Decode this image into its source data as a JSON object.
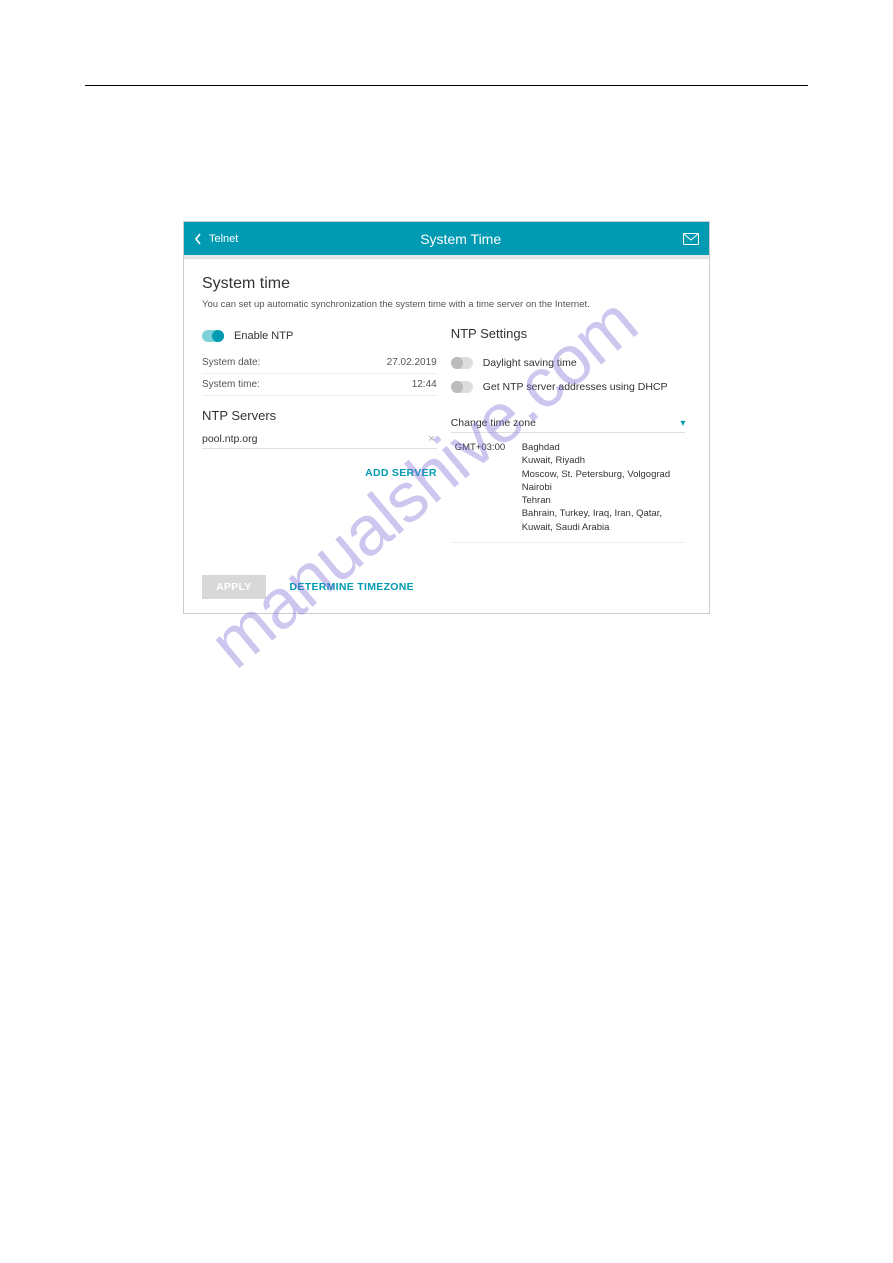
{
  "header": {
    "back_label": "Telnet",
    "title": "System Time"
  },
  "section": {
    "heading": "System time",
    "description": "You can set up automatic synchronization the system time with a time server on the Internet."
  },
  "left": {
    "enable_ntp_label": "Enable NTP",
    "system_date_label": "System date:",
    "system_date_value": "27.02.2019",
    "system_time_label": "System time:",
    "system_time_value": "12:44",
    "ntp_servers_heading": "NTP Servers",
    "server_value": "pool.ntp.org",
    "add_server_label": "ADD SERVER"
  },
  "right": {
    "ntp_settings_heading": "NTP Settings",
    "dst_label": "Daylight saving time",
    "dhcp_label": "Get NTP server addresses using DHCP",
    "change_tz_label": "Change time zone",
    "tz_offset": "GMT+03:00",
    "tz_cities_1": "Baghdad",
    "tz_cities_2": "Kuwait, Riyadh",
    "tz_cities_3": "Moscow, St. Petersburg, Volgograd",
    "tz_cities_4": "Nairobi",
    "tz_cities_5": "Tehran",
    "tz_cities_6": "Bahrain, Turkey, Iraq, Iran, Qatar, Kuwait, Saudi Arabia"
  },
  "footer": {
    "apply_label": "APPLY",
    "determine_tz_label": "DETERMINE TIMEZONE"
  },
  "watermark": "manualshive.com"
}
